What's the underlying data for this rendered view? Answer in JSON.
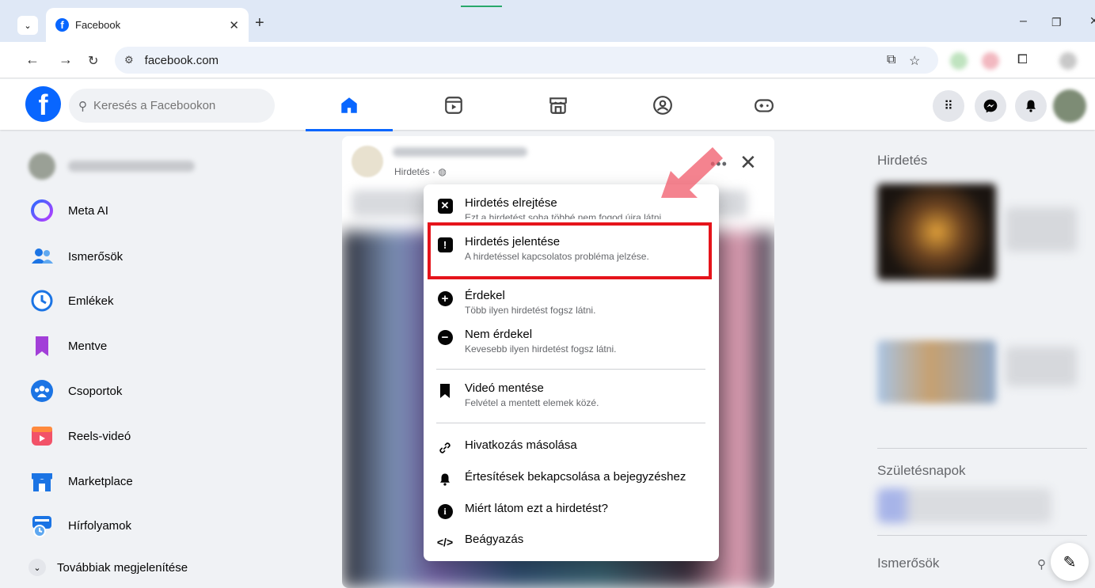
{
  "browser": {
    "tab_title": "Facebook",
    "url": "facebook.com"
  },
  "header": {
    "search_placeholder": "Keresés a Facebookon"
  },
  "sidebar": {
    "items": [
      {
        "label": "Meta AI"
      },
      {
        "label": "Ismerősök"
      },
      {
        "label": "Emlékek"
      },
      {
        "label": "Mentve"
      },
      {
        "label": "Csoportok"
      },
      {
        "label": "Reels-videó"
      },
      {
        "label": "Marketplace"
      },
      {
        "label": "Hírfolyamok"
      }
    ],
    "more_label": "Továbbiak megjelenítése"
  },
  "post": {
    "meta": "Hirdetés · ◍"
  },
  "menu": {
    "items": [
      {
        "title": "Hirdetés elrejtése",
        "subtitle": "Ezt a hirdetést soha többé nem fogod újra látni."
      },
      {
        "title": "Hirdetés jelentése",
        "subtitle": "A hirdetéssel kapcsolatos probléma jelzése."
      },
      {
        "title": "Érdekel",
        "subtitle": "Több ilyen hirdetést fogsz látni."
      },
      {
        "title": "Nem érdekel",
        "subtitle": "Kevesebb ilyen hirdetést fogsz látni."
      },
      {
        "title": "Videó mentése",
        "subtitle": "Felvétel a mentett elemek közé."
      },
      {
        "title": "Hivatkozás másolása"
      },
      {
        "title": "Értesítések bekapcsolása a bejegyzéshez"
      },
      {
        "title": "Miért látom ezt a hirdetést?"
      },
      {
        "title": "Beágyazás"
      }
    ]
  },
  "right": {
    "ads_heading": "Hirdetés",
    "birthdays_heading": "Születésnapok",
    "friends_heading": "Ismerősök"
  },
  "colors": {
    "brand": "#0866ff",
    "highlight": "#e5141b"
  }
}
